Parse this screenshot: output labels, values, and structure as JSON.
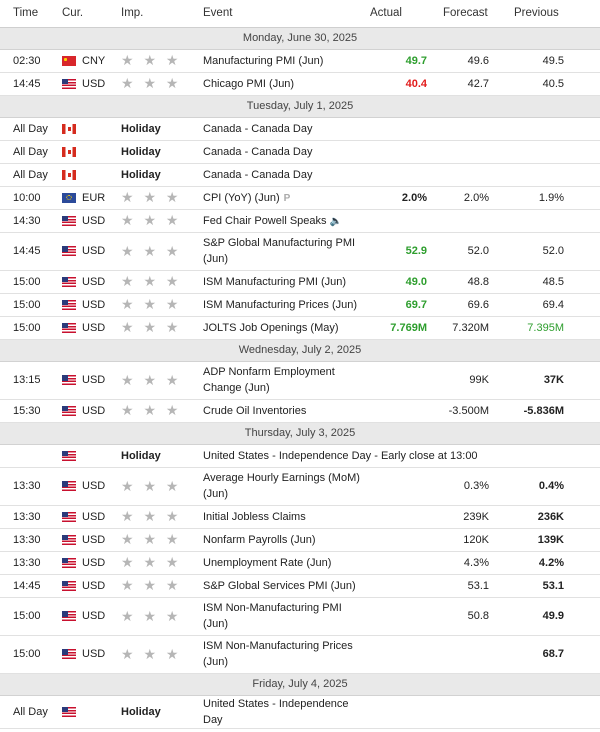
{
  "headers": {
    "time": "Time",
    "cur": "Cur.",
    "imp": "Imp.",
    "event": "Event",
    "actual": "Actual",
    "forecast": "Forecast",
    "previous": "Previous"
  },
  "days": [
    {
      "label": "Monday, June 30, 2025",
      "events": [
        {
          "time": "02:30",
          "flag": "cn",
          "cur": "CNY",
          "imp": "stars",
          "event": "Manufacturing PMI (Jun)",
          "actual": "49.7",
          "actual_style": "green",
          "forecast": "49.6",
          "previous": "49.5",
          "previous_style": "plain",
          "row": "ev"
        },
        {
          "time": "14:45",
          "flag": "us",
          "cur": "USD",
          "imp": "stars",
          "event": "Chicago PMI (Jun)",
          "actual": "40.4",
          "actual_style": "red",
          "forecast": "42.7",
          "previous": "40.5",
          "previous_style": "plain",
          "row": "ev"
        }
      ]
    },
    {
      "label": "Tuesday, July 1, 2025",
      "events": [
        {
          "time": "All Day",
          "flag": "ca",
          "cur": "",
          "imp": "Holiday",
          "event": "Canada - Canada Day",
          "actual": "",
          "forecast": "",
          "previous": "",
          "row": "ev"
        },
        {
          "time": "All Day",
          "flag": "ca",
          "cur": "",
          "imp": "Holiday",
          "event": "Canada - Canada Day",
          "actual": "",
          "forecast": "",
          "previous": "",
          "row": "ev"
        },
        {
          "time": "All Day",
          "flag": "ca",
          "cur": "",
          "imp": "Holiday",
          "event": "Canada - Canada Day",
          "actual": "",
          "forecast": "",
          "previous": "",
          "row": "ev"
        },
        {
          "time": "10:00",
          "flag": "eu",
          "cur": "EUR",
          "imp": "stars",
          "event": "CPI (YoY) (Jun)",
          "icon": "P",
          "actual": "2.0%",
          "actual_style": "bold",
          "forecast": "2.0%",
          "previous": "1.9%",
          "previous_style": "plain",
          "row": "ev"
        },
        {
          "time": "14:30",
          "flag": "us",
          "cur": "USD",
          "imp": "stars",
          "event": "Fed Chair Powell Speaks",
          "icon": "speaker",
          "actual": "",
          "forecast": "",
          "previous": "",
          "row": "ev"
        },
        {
          "time": "14:45",
          "flag": "us",
          "cur": "USD",
          "imp": "stars",
          "event": "S&P Global Manufacturing PMI (Jun)",
          "actual": "52.9",
          "actual_style": "green",
          "forecast": "52.0",
          "previous": "52.0",
          "previous_style": "plain",
          "row": "tall"
        },
        {
          "time": "15:00",
          "flag": "us",
          "cur": "USD",
          "imp": "stars",
          "event": "ISM Manufacturing PMI (Jun)",
          "actual": "49.0",
          "actual_style": "green",
          "forecast": "48.8",
          "previous": "48.5",
          "previous_style": "plain",
          "row": "ev"
        },
        {
          "time": "15:00",
          "flag": "us",
          "cur": "USD",
          "imp": "stars",
          "event": "ISM Manufacturing Prices (Jun)",
          "actual": "69.7",
          "actual_style": "green",
          "forecast": "69.6",
          "previous": "69.4",
          "previous_style": "plain",
          "row": "ev"
        },
        {
          "time": "15:00",
          "flag": "us",
          "cur": "USD",
          "imp": "stars",
          "event": "JOLTS Job Openings (May)",
          "actual": "7.769M",
          "actual_style": "green",
          "forecast": "7.320M",
          "previous": "7.395M",
          "previous_style": "green-plain",
          "row": "ev"
        }
      ]
    },
    {
      "label": "Wednesday, July 2, 2025",
      "events": [
        {
          "time": "13:15",
          "flag": "us",
          "cur": "USD",
          "imp": "stars",
          "event": "ADP Nonfarm Employment Change (Jun)",
          "actual": "",
          "forecast": "99K",
          "previous": "37K",
          "previous_style": "bold",
          "row": "tall"
        },
        {
          "time": "15:30",
          "flag": "us",
          "cur": "USD",
          "imp": "stars",
          "event": "Crude Oil Inventories",
          "actual": "",
          "forecast": "-3.500M",
          "previous": "-5.836M",
          "previous_style": "bold",
          "row": "ev"
        }
      ]
    },
    {
      "label": "Thursday, July 3, 2025",
      "events": [
        {
          "time": "",
          "flag": "us",
          "cur": "",
          "imp": "Holiday",
          "event": "United States - Independence Day - Early close at 13:00",
          "actual": "",
          "forecast": "",
          "previous": "",
          "row": "ev",
          "wide": true
        },
        {
          "time": "13:30",
          "flag": "us",
          "cur": "USD",
          "imp": "stars",
          "event": "Average Hourly Earnings (MoM) (Jun)",
          "actual": "",
          "forecast": "0.3%",
          "previous": "0.4%",
          "previous_style": "bold",
          "row": "tall"
        },
        {
          "time": "13:30",
          "flag": "us",
          "cur": "USD",
          "imp": "stars",
          "event": "Initial Jobless Claims",
          "actual": "",
          "forecast": "239K",
          "previous": "236K",
          "previous_style": "bold",
          "row": "ev"
        },
        {
          "time": "13:30",
          "flag": "us",
          "cur": "USD",
          "imp": "stars",
          "event": "Nonfarm Payrolls (Jun)",
          "actual": "",
          "forecast": "120K",
          "previous": "139K",
          "previous_style": "bold",
          "row": "ev"
        },
        {
          "time": "13:30",
          "flag": "us",
          "cur": "USD",
          "imp": "stars",
          "event": "Unemployment Rate (Jun)",
          "actual": "",
          "forecast": "4.3%",
          "previous": "4.2%",
          "previous_style": "bold",
          "row": "ev"
        },
        {
          "time": "14:45",
          "flag": "us",
          "cur": "USD",
          "imp": "stars",
          "event": "S&P Global Services PMI (Jun)",
          "actual": "",
          "forecast": "53.1",
          "previous": "53.1",
          "previous_style": "bold",
          "row": "ev"
        },
        {
          "time": "15:00",
          "flag": "us",
          "cur": "USD",
          "imp": "stars",
          "event": "ISM Non-Manufacturing PMI (Jun)",
          "actual": "",
          "forecast": "50.8",
          "previous": "49.9",
          "previous_style": "bold",
          "row": "tall"
        },
        {
          "time": "15:00",
          "flag": "us",
          "cur": "USD",
          "imp": "stars",
          "event": "ISM Non-Manufacturing Prices (Jun)",
          "actual": "",
          "forecast": "",
          "previous": "68.7",
          "previous_style": "bold",
          "row": "tall"
        }
      ]
    },
    {
      "label": "Friday, July 4, 2025",
      "events": [
        {
          "time": "All Day",
          "flag": "us",
          "cur": "",
          "imp": "Holiday",
          "event": "United States - Independence Day",
          "actual": "",
          "forecast": "",
          "previous": "",
          "row": "ev"
        }
      ]
    }
  ],
  "star_glyph": "★ ★ ★"
}
